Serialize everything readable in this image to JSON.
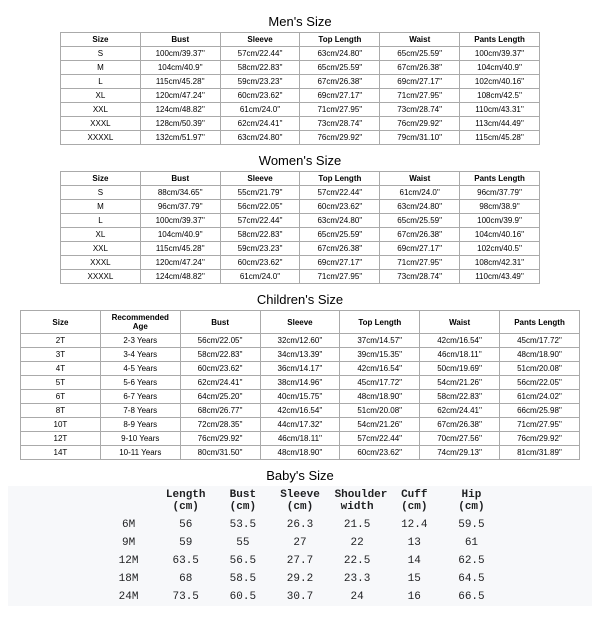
{
  "chart_data": [
    {
      "type": "table",
      "title": "Men's Size",
      "headers": [
        "Size",
        "Bust",
        "Sleeve",
        "Top Length",
        "Waist",
        "Pants Length"
      ],
      "rows": [
        [
          "S",
          "100cm/39.37''",
          "57cm/22.44''",
          "63cm/24.80''",
          "65cm/25.59''",
          "100cm/39.37''"
        ],
        [
          "M",
          "104cm/40.9''",
          "58cm/22.83''",
          "65cm/25.59''",
          "67cm/26.38''",
          "104cm/40.9''"
        ],
        [
          "L",
          "115cm/45.28''",
          "59cm/23.23''",
          "67cm/26.38''",
          "69cm/27.17''",
          "102cm/40.16''"
        ],
        [
          "XL",
          "120cm/47.24''",
          "60cm/23.62''",
          "69cm/27.17''",
          "71cm/27.95''",
          "108cm/42.5''"
        ],
        [
          "XXL",
          "124cm/48.82''",
          "61cm/24.0''",
          "71cm/27.95''",
          "73cm/28.74''",
          "110cm/43.31''"
        ],
        [
          "XXXL",
          "128cm/50.39''",
          "62cm/24.41''",
          "73cm/28.74''",
          "76cm/29.92''",
          "113cm/44.49''"
        ],
        [
          "XXXXL",
          "132cm/51.97''",
          "63cm/24.80''",
          "76cm/29.92''",
          "79cm/31.10''",
          "115cm/45.28''"
        ]
      ]
    },
    {
      "type": "table",
      "title": "Women's Size",
      "headers": [
        "Size",
        "Bust",
        "Sleeve",
        "Top Length",
        "Waist",
        "Pants Length"
      ],
      "rows": [
        [
          "S",
          "88cm/34.65''",
          "55cm/21.79''",
          "57cm/22.44''",
          "61cm/24.0''",
          "96cm/37.79''"
        ],
        [
          "M",
          "96cm/37.79''",
          "56cm/22.05''",
          "60cm/23.62''",
          "63cm/24.80''",
          "98cm/38.9''"
        ],
        [
          "L",
          "100cm/39.37''",
          "57cm/22.44''",
          "63cm/24.80''",
          "65cm/25.59''",
          "100cm/39.9''"
        ],
        [
          "XL",
          "104cm/40.9''",
          "58cm/22.83''",
          "65cm/25.59''",
          "67cm/26.38''",
          "104cm/40.16''"
        ],
        [
          "XXL",
          "115cm/45.28''",
          "59cm/23.23''",
          "67cm/26.38''",
          "69cm/27.17''",
          "102cm/40.5''"
        ],
        [
          "XXXL",
          "120cm/47.24''",
          "60cm/23.62''",
          "69cm/27.17''",
          "71cm/27.95''",
          "108cm/42.31''"
        ],
        [
          "XXXXL",
          "124cm/48.82''",
          "61cm/24.0''",
          "71cm/27.95''",
          "73cm/28.74''",
          "110cm/43.49''"
        ]
      ]
    },
    {
      "type": "table",
      "title": "Children's Size",
      "headers": [
        "Size",
        "Recommended Age",
        "Bust",
        "Sleeve",
        "Top Length",
        "Waist",
        "Pants Length"
      ],
      "rows": [
        [
          "2T",
          "2-3 Years",
          "56cm/22.05''",
          "32cm/12.60''",
          "37cm/14.57''",
          "42cm/16.54''",
          "45cm/17.72''"
        ],
        [
          "3T",
          "3-4 Years",
          "58cm/22.83''",
          "34cm/13.39''",
          "39cm/15.35''",
          "46cm/18.11''",
          "48cm/18.90''"
        ],
        [
          "4T",
          "4-5 Years",
          "60cm/23.62''",
          "36cm/14.17''",
          "42cm/16.54''",
          "50cm/19.69''",
          "51cm/20.08''"
        ],
        [
          "5T",
          "5-6 Years",
          "62cm/24.41''",
          "38cm/14.96''",
          "45cm/17.72''",
          "54cm/21.26''",
          "56cm/22.05''"
        ],
        [
          "6T",
          "6-7 Years",
          "64cm/25.20''",
          "40cm/15.75''",
          "48cm/18.90''",
          "58cm/22.83''",
          "61cm/24.02''"
        ],
        [
          "8T",
          "7-8 Years",
          "68cm/26.77''",
          "42cm/16.54''",
          "51cm/20.08''",
          "62cm/24.41''",
          "66cm/25.98''"
        ],
        [
          "10T",
          "8-9 Years",
          "72cm/28.35''",
          "44cm/17.32''",
          "54cm/21.26''",
          "67cm/26.38''",
          "71cm/27.95''"
        ],
        [
          "12T",
          "9-10 Years",
          "76cm/29.92''",
          "46cm/18.11''",
          "57cm/22.44''",
          "70cm/27.56''",
          "76cm/29.92''"
        ],
        [
          "14T",
          "10-11 Years",
          "80cm/31.50''",
          "48cm/18.90''",
          "60cm/23.62''",
          "74cm/29.13''",
          "81cm/31.89''"
        ]
      ]
    },
    {
      "type": "table",
      "title": "Baby's Size",
      "headers": [
        "",
        "Length (cm)",
        "Bust (cm)",
        "Sleeve (cm)",
        "Shoulder width",
        "Cuff (cm)",
        "Hip (cm)"
      ],
      "rows": [
        [
          "6M",
          "56",
          "53.5",
          "26.3",
          "21.5",
          "12.4",
          "59.5"
        ],
        [
          "9M",
          "59",
          "55",
          "27",
          "22",
          "13",
          "61"
        ],
        [
          "12M",
          "63.5",
          "56.5",
          "27.7",
          "22.5",
          "14",
          "62.5"
        ],
        [
          "18M",
          "68",
          "58.5",
          "29.2",
          "23.3",
          "15",
          "64.5"
        ],
        [
          "24M",
          "73.5",
          "60.5",
          "30.7",
          "24",
          "16",
          "66.5"
        ]
      ]
    }
  ]
}
